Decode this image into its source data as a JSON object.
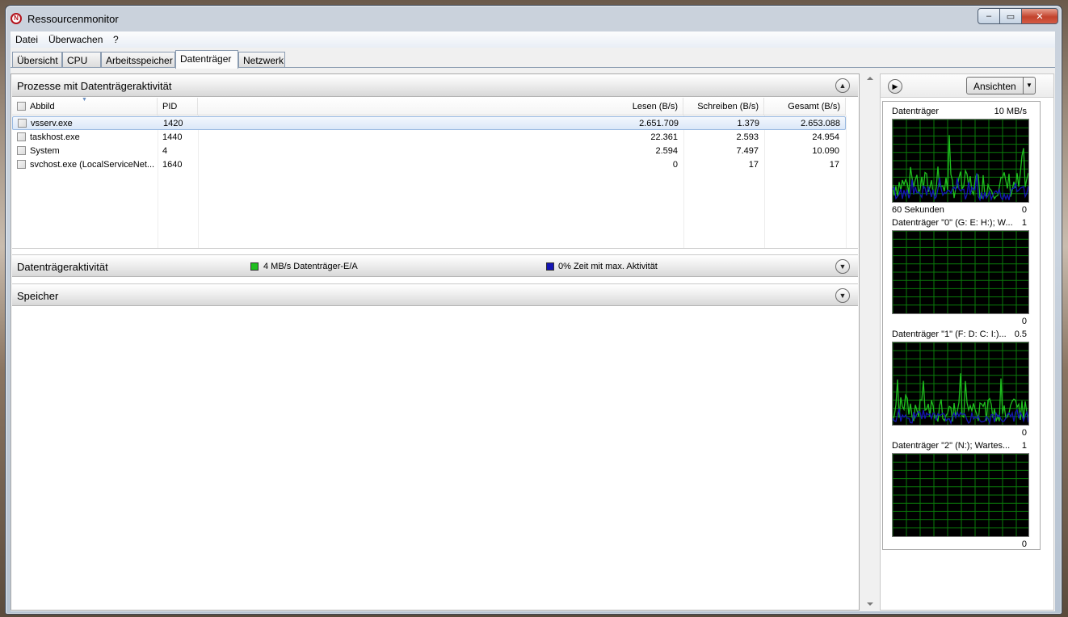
{
  "window": {
    "title": "Ressourcenmonitor",
    "controls": {
      "minimize": "‒",
      "maximize": "▭",
      "close": "✕"
    }
  },
  "menu": [
    "Datei",
    "Überwachen",
    "?"
  ],
  "tabs": [
    {
      "label": "Übersicht",
      "active": false
    },
    {
      "label": "CPU",
      "active": false
    },
    {
      "label": "Arbeitsspeicher",
      "active": false
    },
    {
      "label": "Datenträger",
      "active": true
    },
    {
      "label": "Netzwerk",
      "active": false
    }
  ],
  "processes": {
    "title": "Prozesse mit Datenträgeraktivität",
    "columns": {
      "image": "Abbild",
      "pid": "PID",
      "read": "Lesen (B/s)",
      "write": "Schreiben (B/s)",
      "total": "Gesamt (B/s)"
    },
    "rows": [
      {
        "image": "vsserv.exe",
        "pid": "1420",
        "read": "2.651.709",
        "write": "1.379",
        "total": "2.653.088",
        "selected": true
      },
      {
        "image": "taskhost.exe",
        "pid": "1440",
        "read": "22.361",
        "write": "2.593",
        "total": "24.954",
        "selected": false
      },
      {
        "image": "System",
        "pid": "4",
        "read": "2.594",
        "write": "7.497",
        "total": "10.090",
        "selected": false
      },
      {
        "image": "svchost.exe (LocalServiceNet...",
        "pid": "1640",
        "read": "0",
        "write": "17",
        "total": "17",
        "selected": false
      }
    ]
  },
  "disk_activity": {
    "title": "Datenträgeraktivität",
    "legend_io": "4 MB/s Datenträger-E/A",
    "legend_active": "0% Zeit mit max. Aktivität",
    "colors": {
      "io": "#1fbf1f",
      "active": "#1515b5"
    }
  },
  "storage": {
    "title": "Speicher"
  },
  "right_pane": {
    "views_label": "Ansichten",
    "graphs": [
      {
        "label": "Datenträger",
        "top_value": "10 MB/s",
        "bottom_left": "60 Sekunden",
        "bottom_value": "0"
      },
      {
        "label": "Datenträger \"0\" (G: E: H:); W...",
        "top_value": "1",
        "bottom_left": "",
        "bottom_value": "0"
      },
      {
        "label": "Datenträger \"1\" (F: D: C: I:)...",
        "top_value": "0.5",
        "bottom_left": "",
        "bottom_value": "0"
      },
      {
        "label": "Datenträger \"2\" (N:); Wartes...",
        "top_value": "1",
        "bottom_left": "",
        "bottom_value": "0"
      }
    ]
  }
}
